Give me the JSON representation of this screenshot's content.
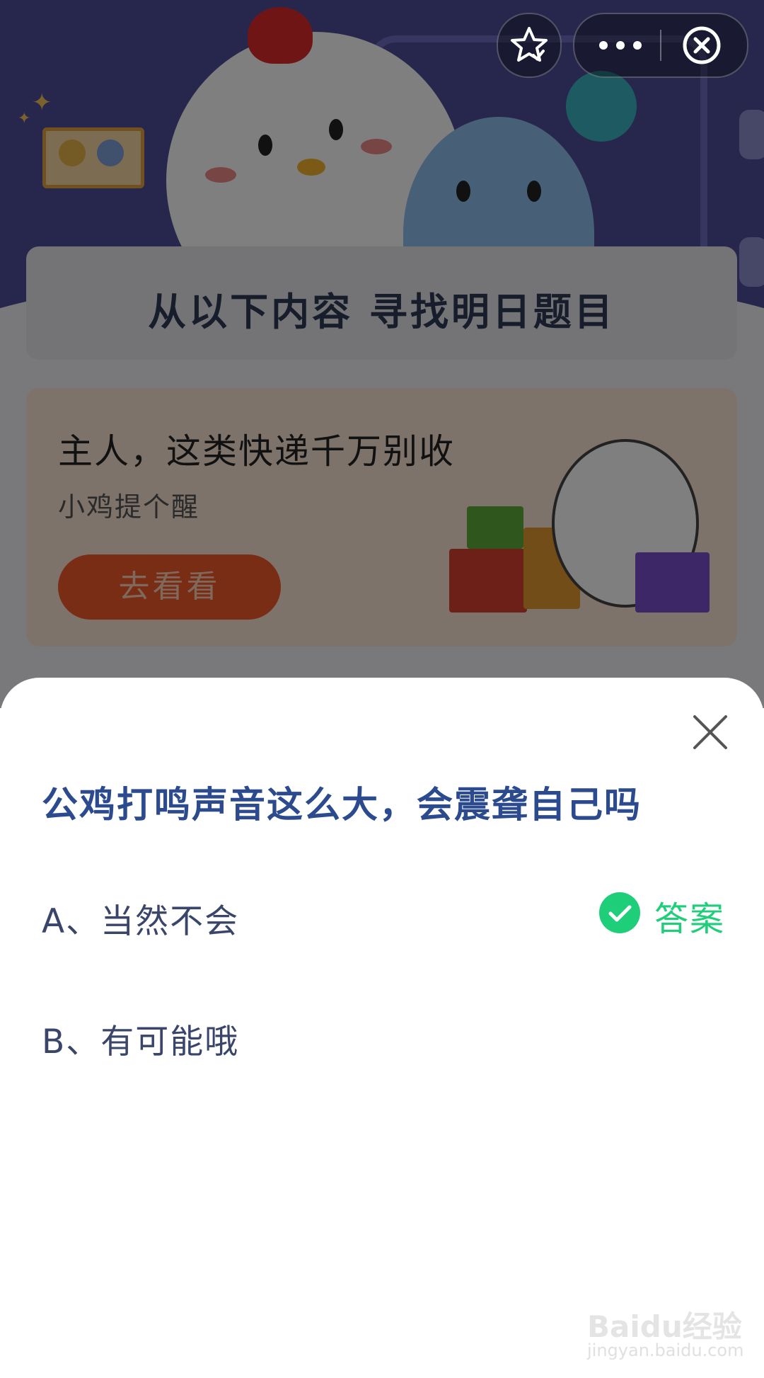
{
  "header": {
    "favorite_icon": "star-check-icon",
    "more_icon": "ellipsis-icon",
    "close_icon": "close-circle-icon"
  },
  "banner": {
    "title": "从以下内容  寻找明日题目"
  },
  "promo": {
    "title": "主人，这类快递千万别收",
    "subtitle": "小鸡提个醒",
    "button_label": "去看看"
  },
  "quiz": {
    "question": "公鸡打鸣声音这么大，会震聋自己吗",
    "options": [
      {
        "label": "A、当然不会",
        "is_answer": true
      },
      {
        "label": "B、有可能哦",
        "is_answer": false
      }
    ],
    "answer_label": "答案",
    "close_icon": "close-icon"
  },
  "watermark": {
    "brand": "Baidu经验",
    "url": "jingyan.baidu.com"
  },
  "colors": {
    "accent_green": "#1fce79",
    "question_blue": "#2c4b8f",
    "promo_orange": "#f45a2a"
  }
}
